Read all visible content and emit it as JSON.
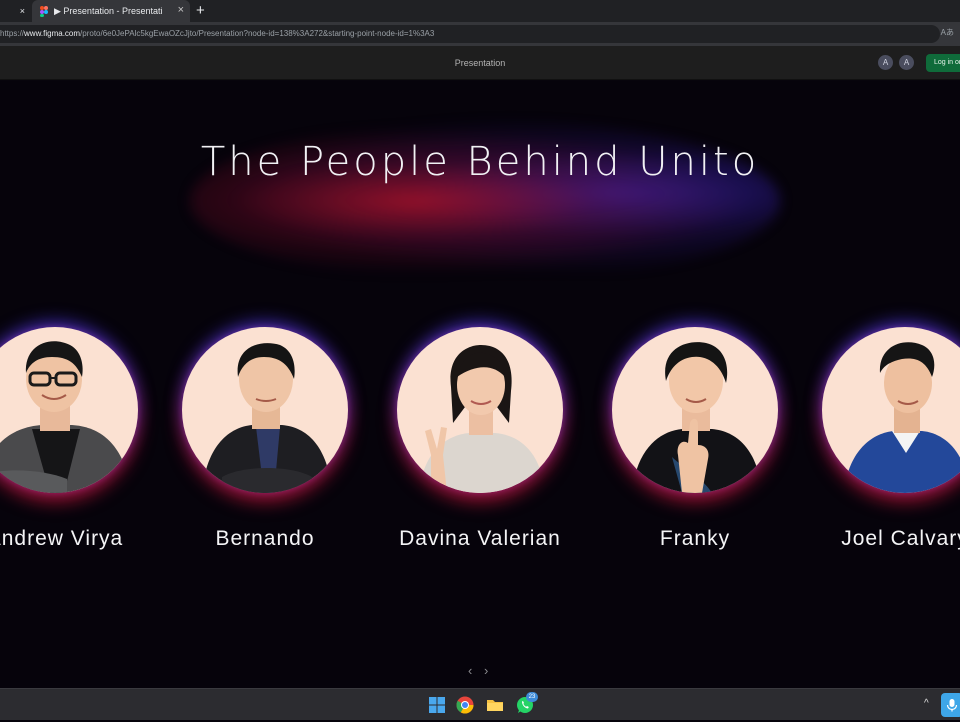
{
  "browser": {
    "prev_tab_close": "×",
    "active_tab": {
      "title": "▶ Presentation - Presentation",
      "close": "×"
    },
    "new_tab": "+",
    "url": {
      "scheme": "https://",
      "host": "www.figma.com",
      "path": "/proto/6e0JePAlc5kgEwaOZcJjto/Presentation?node-id=138%3A272&starting-point-node-id=1%3A3"
    },
    "reader_icon": "Aあ"
  },
  "proto": {
    "title": "Presentation",
    "avatars": [
      "A",
      "A"
    ],
    "login_label": "Log in or"
  },
  "slide": {
    "title": "The People Behind Unito",
    "members": [
      {
        "name": "Andrew Virya"
      },
      {
        "name": "Bernando"
      },
      {
        "name": "Davina Valerian"
      },
      {
        "name": "Franky"
      },
      {
        "name": "Joel Calvary"
      }
    ],
    "nav": {
      "prev": "‹",
      "next": "›"
    }
  },
  "taskbar": {
    "whatsapp_badge": "23",
    "tray_arrow": "^"
  },
  "colors": {
    "accent_red": "#d7193c",
    "accent_blue": "#463ce6",
    "photo_bg": "#fbe1d2"
  }
}
